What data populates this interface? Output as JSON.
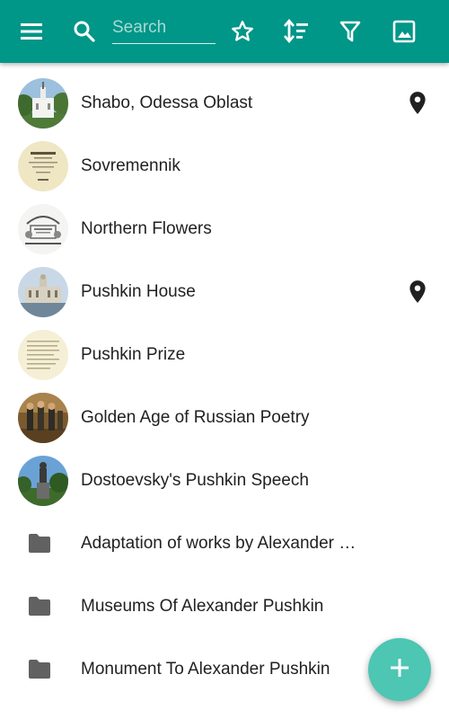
{
  "toolbar": {
    "background": "#009688",
    "menu_icon": "menu-icon",
    "search_icon": "search-icon",
    "search_placeholder": "Search",
    "search_value": "",
    "actions": [
      "star-outline-icon",
      "sort-icon",
      "filter-icon",
      "image-icon"
    ]
  },
  "list": {
    "items": [
      {
        "label": "Shabo, Odessa Oblast",
        "kind": "article",
        "has_location": true
      },
      {
        "label": "Sovremennik",
        "kind": "article",
        "has_location": false
      },
      {
        "label": "Northern Flowers",
        "kind": "article",
        "has_location": false
      },
      {
        "label": "Pushkin House",
        "kind": "article",
        "has_location": true
      },
      {
        "label": "Pushkin Prize",
        "kind": "article",
        "has_location": false
      },
      {
        "label": "Golden Age of Russian Poetry",
        "kind": "article",
        "has_location": false
      },
      {
        "label": "Dostoevsky's Pushkin Speech",
        "kind": "article",
        "has_location": false
      },
      {
        "label": "Adaptation of works by Alexander …",
        "kind": "folder",
        "has_location": false
      },
      {
        "label": "Museums Of Alexander Pushkin",
        "kind": "folder",
        "has_location": false
      },
      {
        "label": "Monument To Alexander Pushkin",
        "kind": "folder",
        "has_location": false
      }
    ]
  },
  "fab": {
    "icon": "plus-icon",
    "color": "#4dc6b3"
  }
}
